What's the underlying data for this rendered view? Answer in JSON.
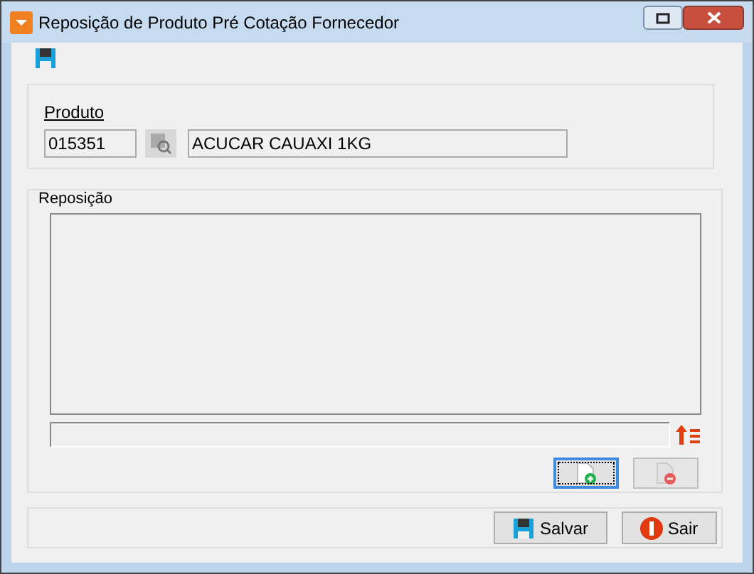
{
  "window": {
    "title": "Reposição de Produto Pré Cotação Fornecedor"
  },
  "produto": {
    "label": "Produto",
    "code": "015351",
    "name": "ACUCAR CAUAXI 1KG"
  },
  "reposicao": {
    "title": "Reposição"
  },
  "list_buttons": [
    {
      "kind": "add",
      "focused": true,
      "disabled": false
    },
    {
      "kind": "remove",
      "focused": false,
      "disabled": true
    }
  ],
  "footer_buttons": [
    {
      "kind": "save",
      "label": "Salvar"
    },
    {
      "kind": "exit",
      "label": "Sair"
    }
  ]
}
